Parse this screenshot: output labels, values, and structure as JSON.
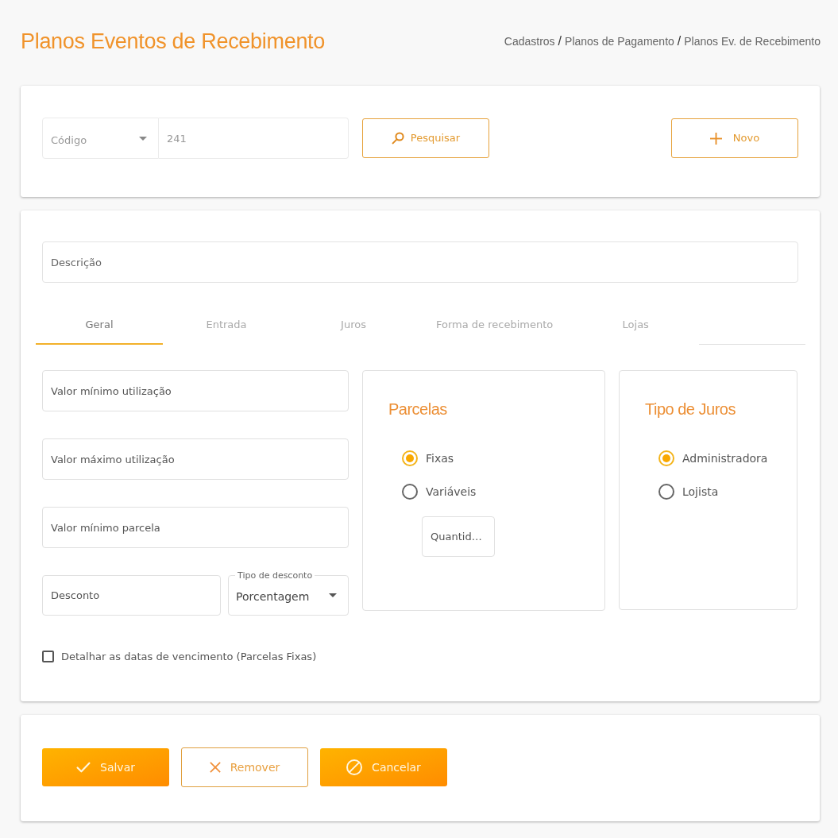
{
  "header": {
    "title": "Planos Eventos de Recebimento",
    "breadcrumb": [
      {
        "kind": "link",
        "text": "Cadastros"
      },
      {
        "kind": "separator",
        "text": "/"
      },
      {
        "kind": "link",
        "text": "Planos de Pagamento"
      },
      {
        "kind": "separator",
        "text": "/"
      },
      {
        "kind": "link",
        "text": "Planos Ev. de Recebimento"
      }
    ]
  },
  "search": {
    "filter_select": {
      "value": "Código"
    },
    "search_field": {
      "placeholder": "241"
    },
    "buttons": [
      {
        "kind": "search",
        "label": "Pesquisar"
      },
      {
        "kind": "new",
        "label": "Novo"
      }
    ]
  },
  "form": {
    "description_field": {
      "placeholder": "Descrição"
    },
    "tabs": [
      {
        "label": "Geral",
        "selected": true
      },
      {
        "label": "Entrada",
        "selected": false
      },
      {
        "label": "Juros",
        "selected": false
      },
      {
        "label": "Forma de recebimento",
        "selected": false
      },
      {
        "label": "Lojas",
        "selected": false
      }
    ],
    "fields": [
      {
        "placeholder": "Valor mínimo utilização"
      },
      {
        "placeholder": "Valor máximo utilização"
      },
      {
        "placeholder": "Valor mínimo parcela"
      }
    ],
    "discount_field": {
      "placeholder": "Desconto"
    },
    "discount_type_select": {
      "label": "Tipo de desconto",
      "value": "Porcentagem"
    },
    "detail_dates_checkbox": {
      "label": "Detalhar as datas de vencimento (Parcelas Fixas)",
      "checked": false
    },
    "installments_panel": {
      "title": "Parcelas",
      "options": [
        {
          "label": "Fixas",
          "selected": true
        },
        {
          "label": "Variáveis",
          "selected": false
        }
      ],
      "quantity_field": {
        "placeholder": "Quantid…"
      }
    },
    "interest_type_panel": {
      "title": "Tipo de Juros",
      "options": [
        {
          "label": "Administradora",
          "selected": true
        },
        {
          "label": "Lojista",
          "selected": false
        }
      ]
    }
  },
  "actions": [
    {
      "kind": "save",
      "label": "Salvar"
    },
    {
      "kind": "remove",
      "label": "Remover"
    },
    {
      "kind": "cancel",
      "label": "Cancelar"
    }
  ]
}
